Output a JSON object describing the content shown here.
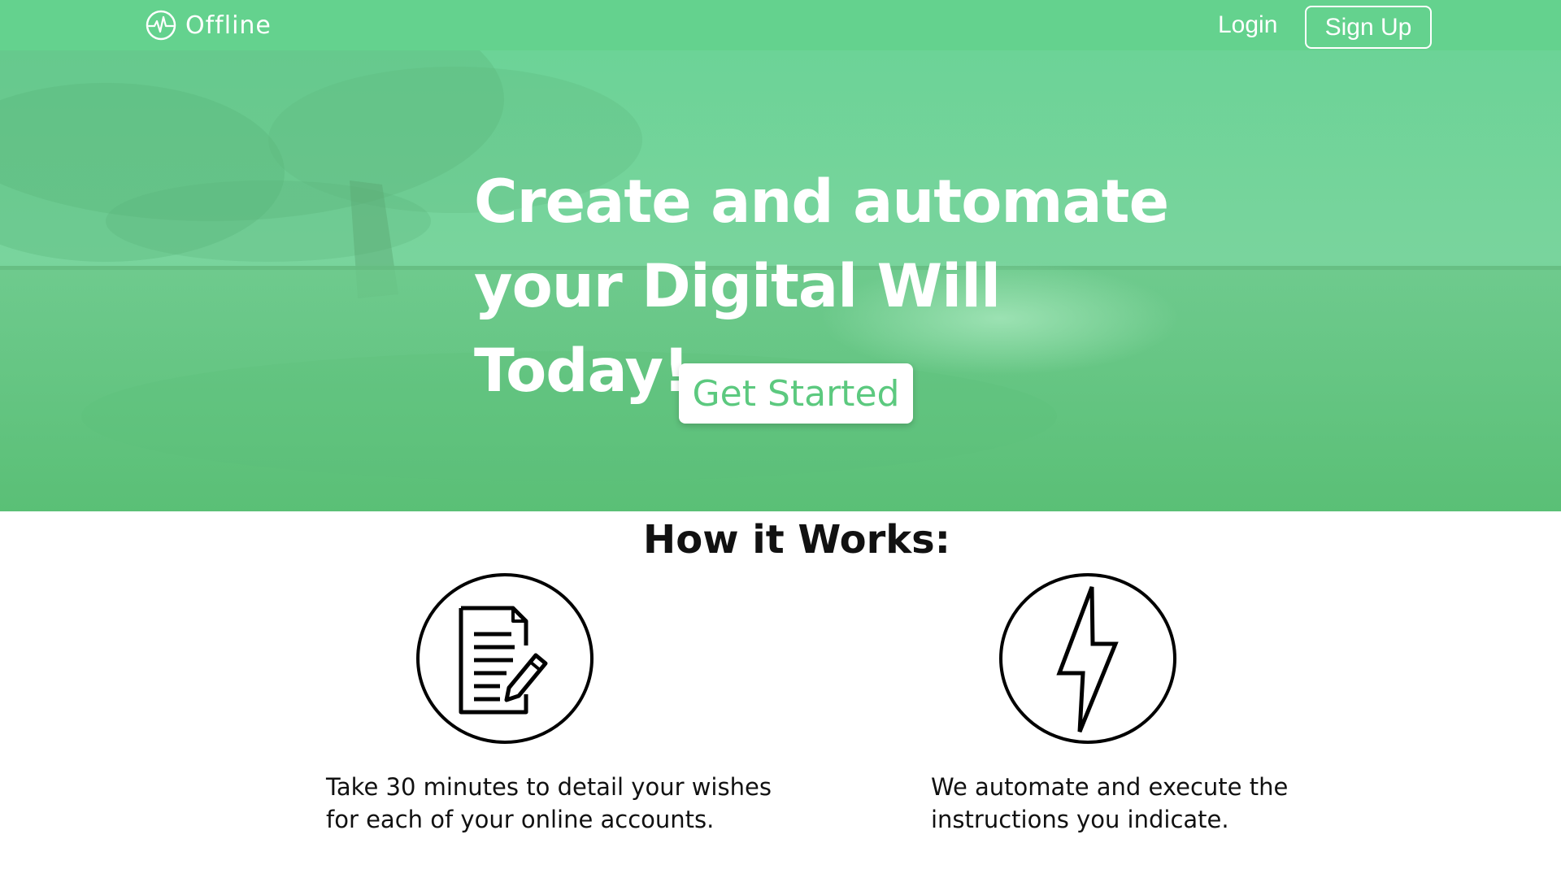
{
  "navbar": {
    "brand_name": "Offline",
    "login_label": "Login",
    "signup_label": "Sign Up",
    "background_color": "#64d28e"
  },
  "hero": {
    "title_line1": "Create and automate",
    "title_line2": "your Digital Will Today!",
    "cta_label": "Get Started",
    "overlay_color": "#6fd094"
  },
  "how_it_works": {
    "title": "How it Works:",
    "steps": [
      {
        "icon": "document-edit-icon",
        "text_line1": "Take 30 minutes to detail your wishes",
        "text_line2": "for each of your online accounts."
      },
      {
        "icon": "lightning-bolt-icon",
        "text_line1": "We automate and execute the",
        "text_line2": "instructions you indicate."
      }
    ]
  }
}
